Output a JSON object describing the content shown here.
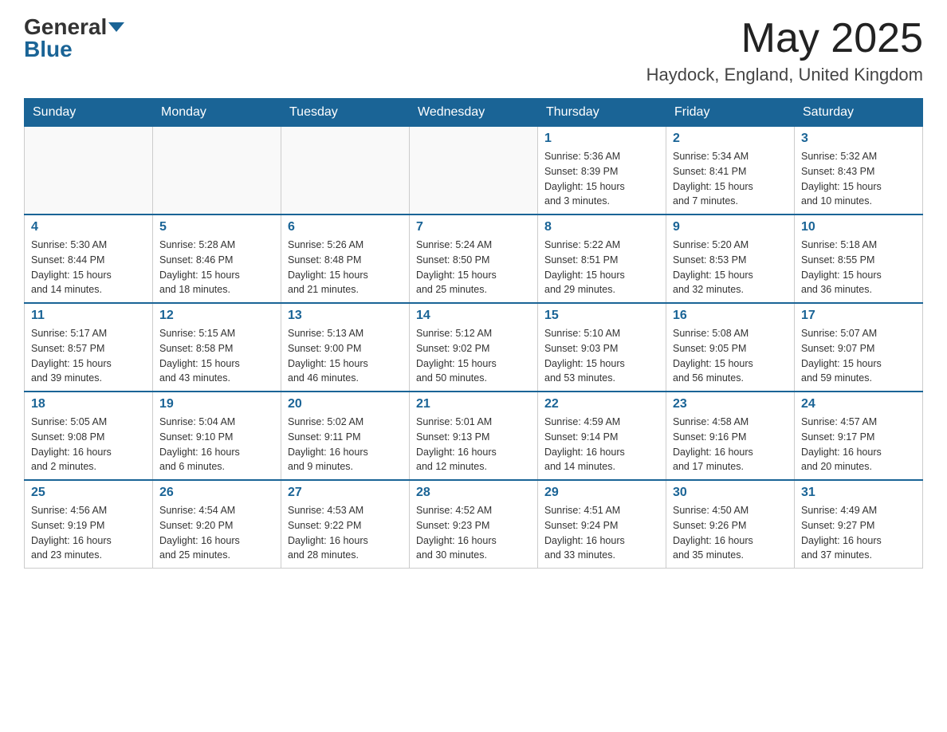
{
  "header": {
    "logo_general": "General",
    "logo_blue": "Blue",
    "month_year": "May 2025",
    "location": "Haydock, England, United Kingdom"
  },
  "days_of_week": [
    "Sunday",
    "Monday",
    "Tuesday",
    "Wednesday",
    "Thursday",
    "Friday",
    "Saturday"
  ],
  "weeks": [
    [
      {
        "day": "",
        "info": ""
      },
      {
        "day": "",
        "info": ""
      },
      {
        "day": "",
        "info": ""
      },
      {
        "day": "",
        "info": ""
      },
      {
        "day": "1",
        "info": "Sunrise: 5:36 AM\nSunset: 8:39 PM\nDaylight: 15 hours\nand 3 minutes."
      },
      {
        "day": "2",
        "info": "Sunrise: 5:34 AM\nSunset: 8:41 PM\nDaylight: 15 hours\nand 7 minutes."
      },
      {
        "day": "3",
        "info": "Sunrise: 5:32 AM\nSunset: 8:43 PM\nDaylight: 15 hours\nand 10 minutes."
      }
    ],
    [
      {
        "day": "4",
        "info": "Sunrise: 5:30 AM\nSunset: 8:44 PM\nDaylight: 15 hours\nand 14 minutes."
      },
      {
        "day": "5",
        "info": "Sunrise: 5:28 AM\nSunset: 8:46 PM\nDaylight: 15 hours\nand 18 minutes."
      },
      {
        "day": "6",
        "info": "Sunrise: 5:26 AM\nSunset: 8:48 PM\nDaylight: 15 hours\nand 21 minutes."
      },
      {
        "day": "7",
        "info": "Sunrise: 5:24 AM\nSunset: 8:50 PM\nDaylight: 15 hours\nand 25 minutes."
      },
      {
        "day": "8",
        "info": "Sunrise: 5:22 AM\nSunset: 8:51 PM\nDaylight: 15 hours\nand 29 minutes."
      },
      {
        "day": "9",
        "info": "Sunrise: 5:20 AM\nSunset: 8:53 PM\nDaylight: 15 hours\nand 32 minutes."
      },
      {
        "day": "10",
        "info": "Sunrise: 5:18 AM\nSunset: 8:55 PM\nDaylight: 15 hours\nand 36 minutes."
      }
    ],
    [
      {
        "day": "11",
        "info": "Sunrise: 5:17 AM\nSunset: 8:57 PM\nDaylight: 15 hours\nand 39 minutes."
      },
      {
        "day": "12",
        "info": "Sunrise: 5:15 AM\nSunset: 8:58 PM\nDaylight: 15 hours\nand 43 minutes."
      },
      {
        "day": "13",
        "info": "Sunrise: 5:13 AM\nSunset: 9:00 PM\nDaylight: 15 hours\nand 46 minutes."
      },
      {
        "day": "14",
        "info": "Sunrise: 5:12 AM\nSunset: 9:02 PM\nDaylight: 15 hours\nand 50 minutes."
      },
      {
        "day": "15",
        "info": "Sunrise: 5:10 AM\nSunset: 9:03 PM\nDaylight: 15 hours\nand 53 minutes."
      },
      {
        "day": "16",
        "info": "Sunrise: 5:08 AM\nSunset: 9:05 PM\nDaylight: 15 hours\nand 56 minutes."
      },
      {
        "day": "17",
        "info": "Sunrise: 5:07 AM\nSunset: 9:07 PM\nDaylight: 15 hours\nand 59 minutes."
      }
    ],
    [
      {
        "day": "18",
        "info": "Sunrise: 5:05 AM\nSunset: 9:08 PM\nDaylight: 16 hours\nand 2 minutes."
      },
      {
        "day": "19",
        "info": "Sunrise: 5:04 AM\nSunset: 9:10 PM\nDaylight: 16 hours\nand 6 minutes."
      },
      {
        "day": "20",
        "info": "Sunrise: 5:02 AM\nSunset: 9:11 PM\nDaylight: 16 hours\nand 9 minutes."
      },
      {
        "day": "21",
        "info": "Sunrise: 5:01 AM\nSunset: 9:13 PM\nDaylight: 16 hours\nand 12 minutes."
      },
      {
        "day": "22",
        "info": "Sunrise: 4:59 AM\nSunset: 9:14 PM\nDaylight: 16 hours\nand 14 minutes."
      },
      {
        "day": "23",
        "info": "Sunrise: 4:58 AM\nSunset: 9:16 PM\nDaylight: 16 hours\nand 17 minutes."
      },
      {
        "day": "24",
        "info": "Sunrise: 4:57 AM\nSunset: 9:17 PM\nDaylight: 16 hours\nand 20 minutes."
      }
    ],
    [
      {
        "day": "25",
        "info": "Sunrise: 4:56 AM\nSunset: 9:19 PM\nDaylight: 16 hours\nand 23 minutes."
      },
      {
        "day": "26",
        "info": "Sunrise: 4:54 AM\nSunset: 9:20 PM\nDaylight: 16 hours\nand 25 minutes."
      },
      {
        "day": "27",
        "info": "Sunrise: 4:53 AM\nSunset: 9:22 PM\nDaylight: 16 hours\nand 28 minutes."
      },
      {
        "day": "28",
        "info": "Sunrise: 4:52 AM\nSunset: 9:23 PM\nDaylight: 16 hours\nand 30 minutes."
      },
      {
        "day": "29",
        "info": "Sunrise: 4:51 AM\nSunset: 9:24 PM\nDaylight: 16 hours\nand 33 minutes."
      },
      {
        "day": "30",
        "info": "Sunrise: 4:50 AM\nSunset: 9:26 PM\nDaylight: 16 hours\nand 35 minutes."
      },
      {
        "day": "31",
        "info": "Sunrise: 4:49 AM\nSunset: 9:27 PM\nDaylight: 16 hours\nand 37 minutes."
      }
    ]
  ]
}
